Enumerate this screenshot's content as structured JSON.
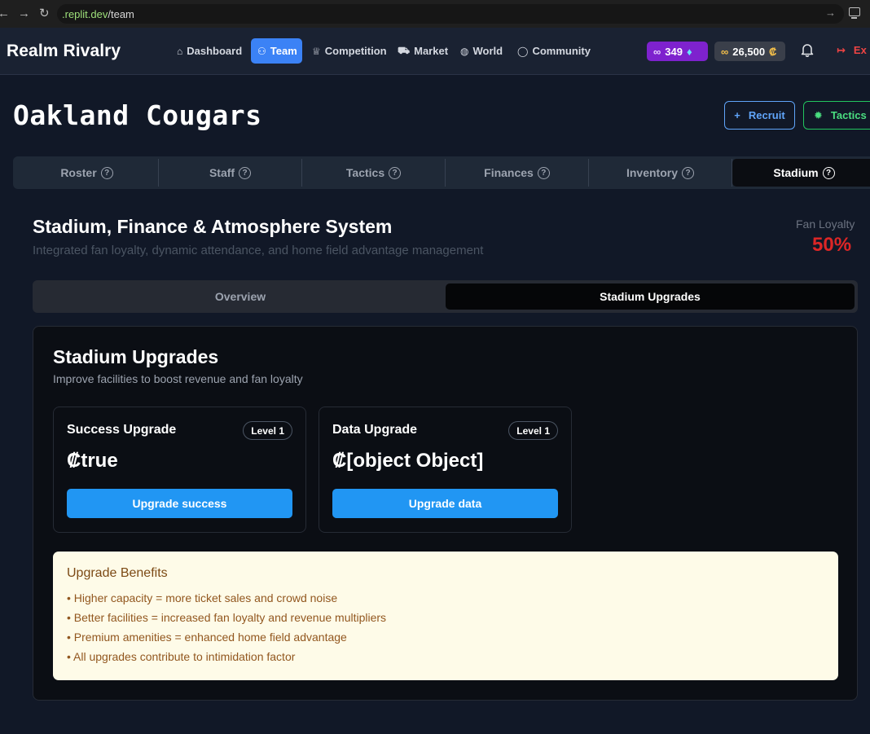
{
  "browser": {
    "url_host": ".replit.dev",
    "url_path": "/team"
  },
  "header": {
    "brand": "Realm Rivalry",
    "nav": [
      {
        "label": "Dashboard",
        "icon": "home-icon"
      },
      {
        "label": "Team",
        "icon": "users-icon"
      },
      {
        "label": "Competition",
        "icon": "trophy-icon"
      },
      {
        "label": "Market",
        "icon": "cart-icon"
      },
      {
        "label": "World",
        "icon": "globe-icon"
      },
      {
        "label": "Community",
        "icon": "chat-icon"
      }
    ],
    "active_nav": "Team",
    "gems": "349",
    "credits": "26,500",
    "credit_symbol": "₡",
    "exit_label": "Ex"
  },
  "page": {
    "team_name": "Oakland Cougars",
    "recruit_label": "Recruit",
    "tactics_label": "Tactics"
  },
  "tabs": {
    "items": [
      "Roster",
      "Staff",
      "Tactics",
      "Finances",
      "Inventory",
      "Stadium"
    ],
    "active": "Stadium"
  },
  "stadium": {
    "title": "Stadium, Finance & Atmosphere System",
    "subtitle": "Integrated fan loyalty, dynamic attendance, and home field advantage management",
    "loyalty_label": "Fan Loyalty",
    "loyalty_value": "50%",
    "subtabs": [
      "Overview",
      "Stadium Upgrades"
    ],
    "active_subtab": "Stadium Upgrades"
  },
  "upgrades": {
    "title": "Stadium Upgrades",
    "subtitle": "Improve facilities to boost revenue and fan loyalty",
    "items": [
      {
        "name": "Success Upgrade",
        "level": "Level 1",
        "cost": "₡true",
        "button": "Upgrade success"
      },
      {
        "name": "Data Upgrade",
        "level": "Level 1",
        "cost": "₡[object Object]",
        "button": "Upgrade data"
      }
    ]
  },
  "benefits": {
    "title": "Upgrade Benefits",
    "items": [
      "• Higher capacity = more ticket sales and crowd noise",
      "• Better facilities = increased fan loyalty and revenue multipliers",
      "• Premium amenities = enhanced home field advantage",
      "• All upgrades contribute to intimidation factor"
    ]
  },
  "colors": {
    "accent": "#3b82f6",
    "loyalty": "#dc2626",
    "upgrade_button": "#2196f3",
    "benefits_bg": "#fefbe8"
  }
}
